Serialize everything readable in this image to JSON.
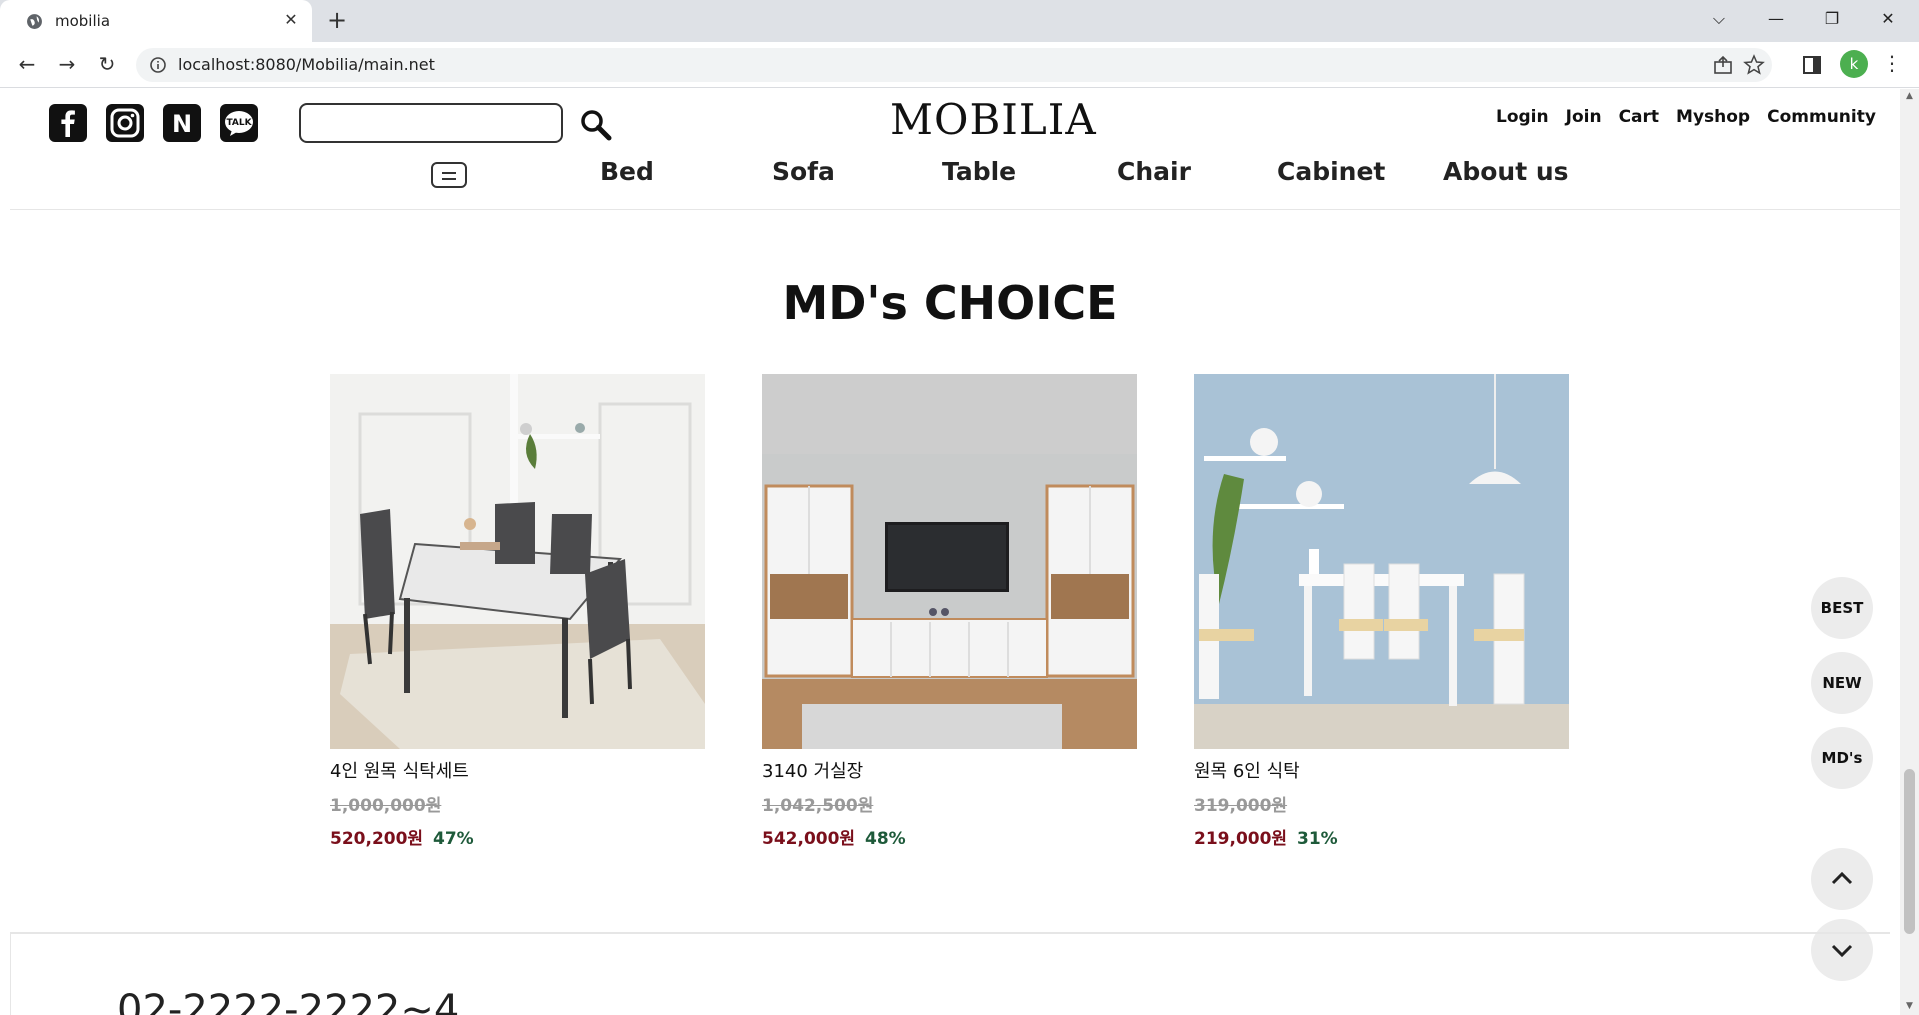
{
  "browser": {
    "tab_title": "mobilia",
    "url": "localhost:8080/Mobilia/main.net",
    "profile_initial": "k"
  },
  "header": {
    "logo": "MOBILIA",
    "search": {
      "value": "",
      "placeholder": ""
    },
    "top_links": [
      "Login",
      "Join",
      "Cart",
      "Myshop",
      "Community"
    ],
    "social_icons": [
      "facebook-icon",
      "instagram-icon",
      "naver-icon",
      "kakaotalk-icon"
    ],
    "kakao_label": "TALK",
    "naver_label": "N",
    "nav": [
      "Bed",
      "Sofa",
      "Table",
      "Chair",
      "Cabinet",
      "About us"
    ]
  },
  "section": {
    "title": "MD's CHOICE",
    "products": [
      {
        "name": "4인 원목 식탁세트",
        "original_price": "1,000,000원",
        "sale_price": "520,200원",
        "discount": "47%"
      },
      {
        "name": "3140 거실장",
        "original_price": "1,042,500원",
        "sale_price": "542,000원",
        "discount": "48%"
      },
      {
        "name": "원목 6인 식탁",
        "original_price": "319,000원",
        "sale_price": "219,000원",
        "discount": "31%"
      }
    ]
  },
  "floating": {
    "best": "BEST",
    "new": "NEW",
    "mds": "MD's"
  },
  "footer": {
    "phone": "02-2222-2222~4"
  },
  "colors": {
    "sale_price": "#7a0f1b",
    "discount": "#1e5a3a",
    "strike": "#999999",
    "profile": "#4caf50"
  }
}
